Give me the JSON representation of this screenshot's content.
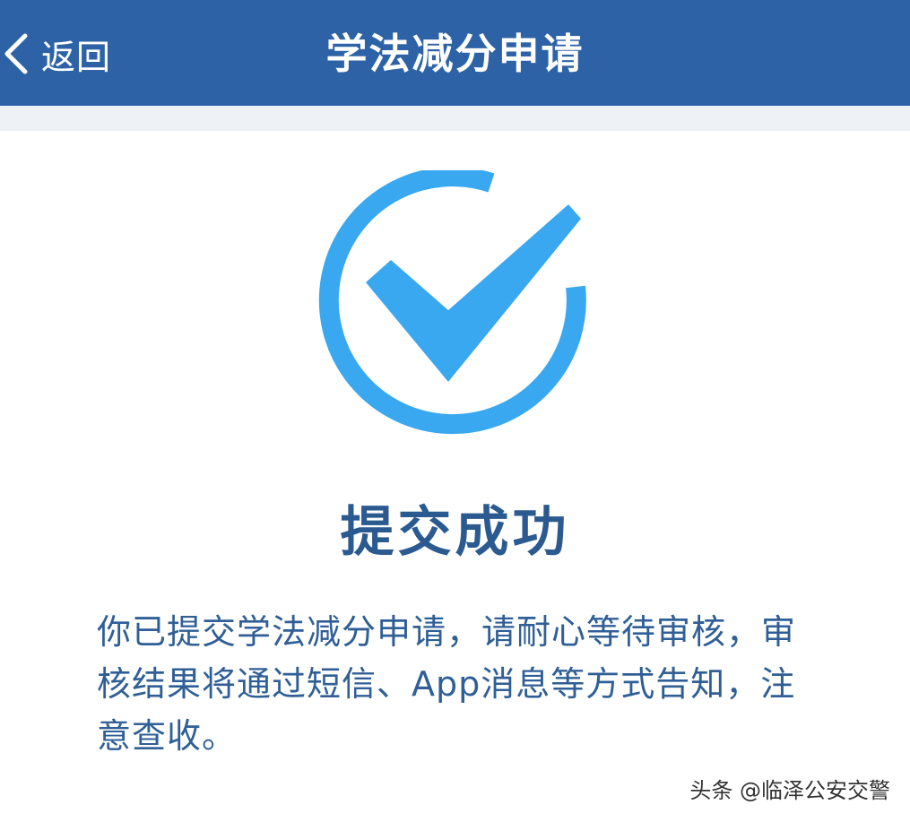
{
  "header": {
    "back_label": "返回",
    "title": "学法减分申请"
  },
  "result": {
    "title": "提交成功",
    "message": "你已提交学法减分申请，请耐心等待审核，审核结果将通过短信、App消息等方式告知，注意查收。"
  },
  "icons": {
    "back": "chevron-left-icon",
    "success": "check-circle-icon"
  },
  "colors": {
    "header_bg": "#2d63a6",
    "accent": "#3aa8f0",
    "text_primary": "#2b5a90"
  },
  "watermark": "头条 @临泽公安交警"
}
